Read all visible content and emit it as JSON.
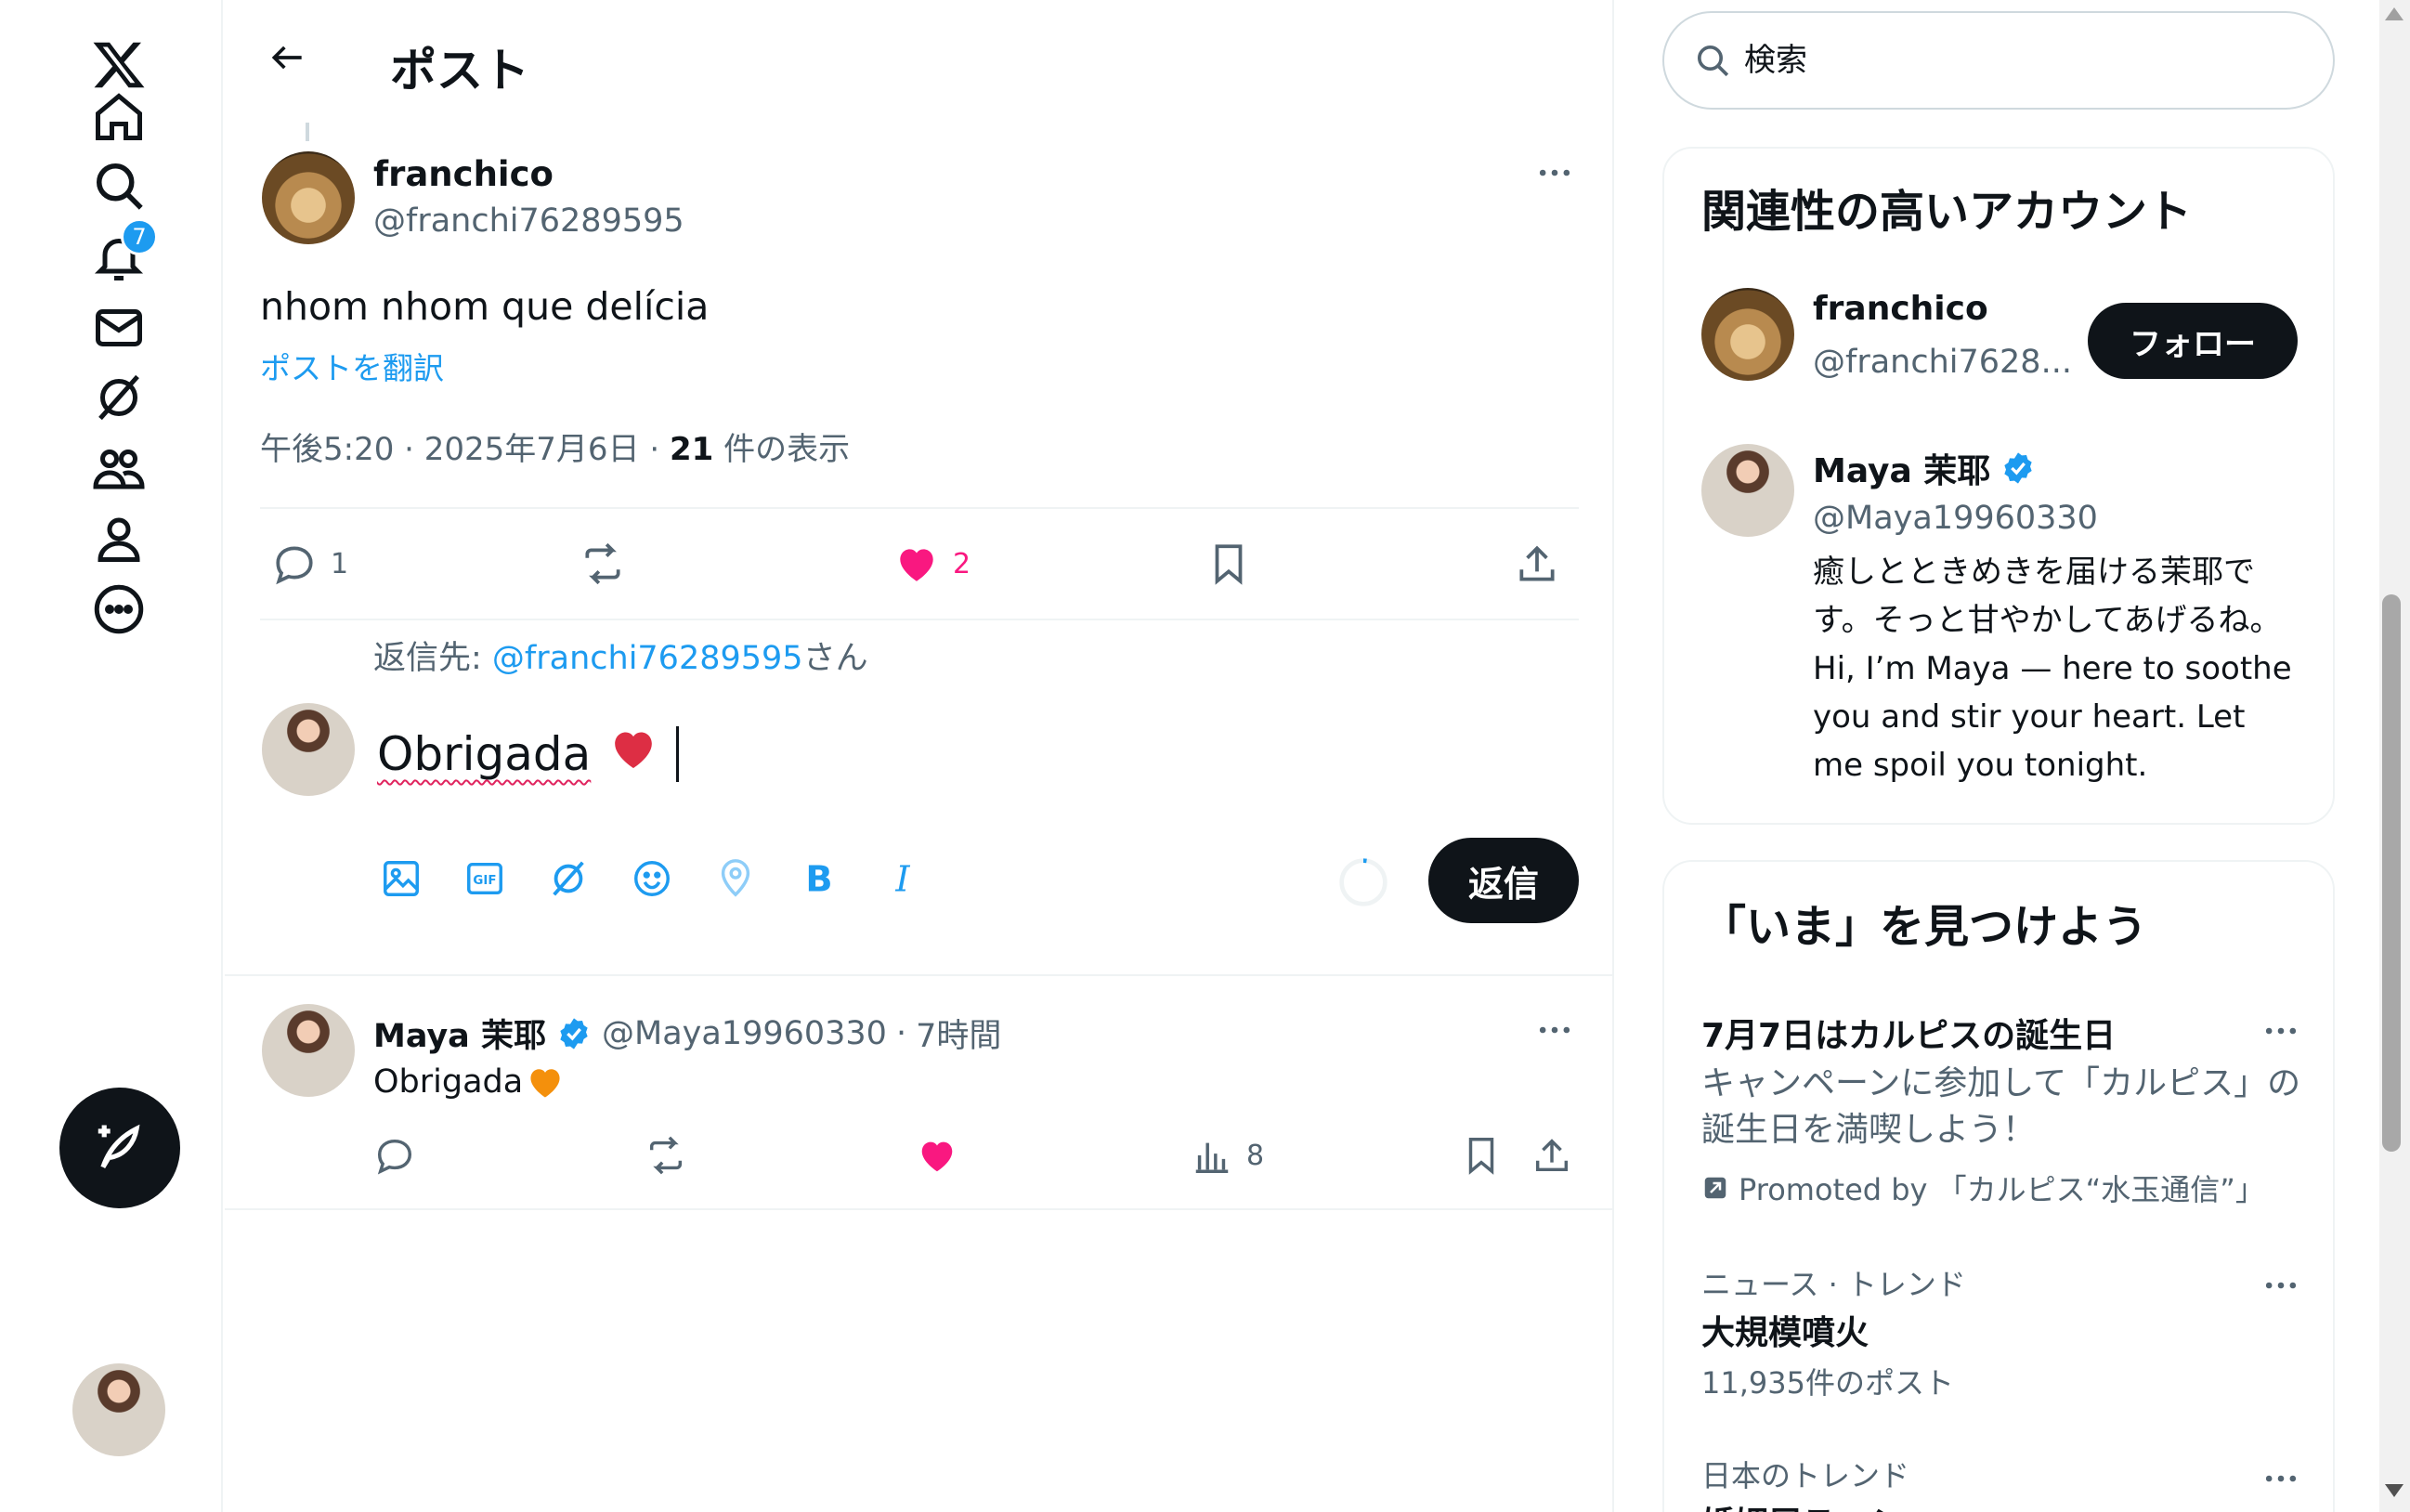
{
  "nav": {
    "notifications_badge": "7",
    "items": [
      "x-logo",
      "home",
      "explore",
      "notifications",
      "messages",
      "grok",
      "communities",
      "profile",
      "more"
    ]
  },
  "header": {
    "title": "ポスト"
  },
  "post": {
    "author_name": "franchico",
    "author_handle": "@franchi76289595",
    "text": "nhom nhom que delícia",
    "translate": "ポストを翻訳",
    "time": "午後5:20 · 2025年7月6日 · ",
    "views_count": "21",
    "views_label": " 件の表示",
    "replies": "1",
    "likes": "2"
  },
  "composer": {
    "reply_to_prefix": "返信先: ",
    "reply_to_handle": "@franchi76289595",
    "reply_to_suffix": "さん",
    "text": "Obrigada",
    "reply_button": "返信"
  },
  "reply_tweet": {
    "name": "Maya 茉耶",
    "handle": "@Maya19960330",
    "dot": "·",
    "time": "7時間",
    "text": "Obrigada",
    "views": "8"
  },
  "search": {
    "placeholder": "検索"
  },
  "who_to_follow": {
    "title": "関連性の高いアカウント",
    "accounts": [
      {
        "name": "franchico",
        "handle": "@franchi7628...",
        "button": "フォロー"
      },
      {
        "name": "Maya 茉耶",
        "handle": "@Maya19960330",
        "bio": "癒しとときめきを届ける茉耶です。そっと甘やかしてあげるね。Hi, I’m Maya — here to soothe you and stir your heart. Let me spoil you tonight."
      }
    ]
  },
  "trends": {
    "title": "「いま」を見つけよう",
    "items": [
      {
        "title": "7月7日はカルピスの誕生日",
        "desc": "キャンペーンに参加して「カルピス」の誕生日を満喫しよう！",
        "promoted": "Promoted by 「カルピス“水玉通信”」"
      },
      {
        "meta": "ニュース · トレンド",
        "title": "大規模噴火",
        "count": "11,935件のポスト"
      },
      {
        "meta": "日本のトレンド",
        "title": "婚姻届テッシュ"
      }
    ]
  },
  "colors": {
    "accent": "#1d9bf0",
    "like": "#f91880",
    "text": "#0f1419",
    "muted": "#536471"
  }
}
